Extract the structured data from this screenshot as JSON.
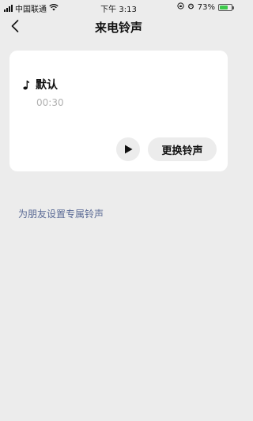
{
  "status_bar": {
    "carrier": "中国联通",
    "time": "下午 3:13",
    "battery_percent": "73%",
    "battery_level": 0.73,
    "icons": [
      "signal-icon",
      "wifi-icon",
      "lock-rotation-icon",
      "alarm-icon",
      "battery-icon"
    ]
  },
  "nav": {
    "title": "来电铃声",
    "back_icon": "chevron-left-icon"
  },
  "ringtone_card": {
    "name": "默认",
    "duration": "00:30",
    "play_icon": "play-icon",
    "change_label": "更换铃声"
  },
  "friend_link": "为朋友设置专属铃声",
  "colors": {
    "background": "#ececec",
    "card": "#ffffff",
    "link": "#5a6a95",
    "muted": "#b0b0b0"
  }
}
